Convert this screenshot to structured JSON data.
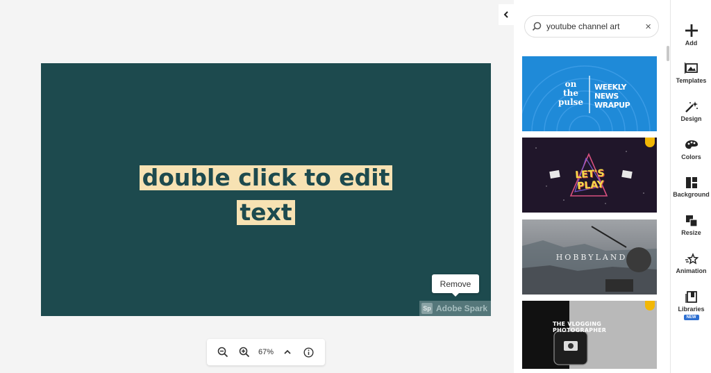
{
  "canvas": {
    "text_line1": "double click to edit",
    "text_line2": "text",
    "background_color": "#1d4a4e",
    "highlight_color": "#f7e2b3",
    "remove_label": "Remove",
    "watermark_badge": "Sp",
    "watermark_text": "Adobe Spark"
  },
  "zoom": {
    "zoom_out_icon": "zoom-out-icon",
    "zoom_in_icon": "zoom-in-icon",
    "value": "67%",
    "expand_icon": "chevron-up-icon",
    "info_icon": "info-icon"
  },
  "panel": {
    "search_value": "youtube channel art",
    "thumbnails": [
      {
        "title_left": "on\nthe\npulse",
        "title_right": "WEEKLY\nNEWS\nWRAPUP"
      },
      {
        "title": "LET'S PLAY",
        "premium": true
      },
      {
        "title": "HOBBYLAND"
      },
      {
        "title": "THE VLOGGING PHOTOGRAPHER",
        "premium": true
      }
    ]
  },
  "rail": {
    "items": [
      {
        "label": "Add",
        "icon": "plus-icon"
      },
      {
        "label": "Templates",
        "icon": "templates-icon"
      },
      {
        "label": "Design",
        "icon": "magic-wand-icon"
      },
      {
        "label": "Colors",
        "icon": "palette-icon"
      },
      {
        "label": "Background",
        "icon": "background-icon"
      },
      {
        "label": "Resize",
        "icon": "resize-icon"
      },
      {
        "label": "Animation",
        "icon": "animation-icon"
      },
      {
        "label": "Libraries",
        "icon": "libraries-icon",
        "badge": "NEW"
      }
    ]
  },
  "colors": {
    "accent": "#2d6fd1",
    "premium": "#f2b705"
  }
}
